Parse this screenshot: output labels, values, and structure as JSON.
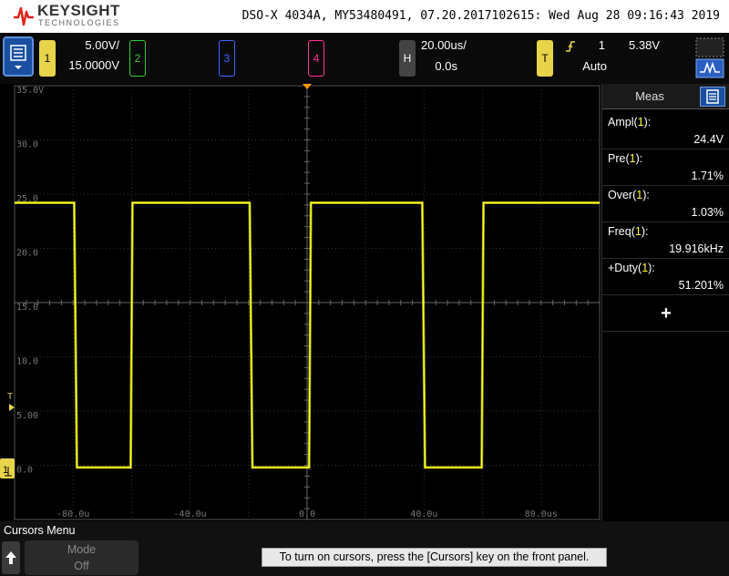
{
  "title_bar": {
    "brand": "KEYSIGHT",
    "brand_sub": "TECHNOLOGIES",
    "title": "DSO-X 4034A, MY53480491, 07.20.2017102615: Wed Aug 28 09:16:43 2019"
  },
  "toolbar": {
    "channels": [
      {
        "number": "1",
        "scale": "5.00V/",
        "offset": "15.0000V",
        "color": "#e8d44a",
        "active": true
      },
      {
        "number": "2",
        "color": "#33cc33",
        "active": false
      },
      {
        "number": "3",
        "color": "#4466ff",
        "active": false
      },
      {
        "number": "4",
        "color": "#ff3399",
        "active": false
      }
    ],
    "horizontal": {
      "label": "H",
      "timebase": "20.00us/",
      "delay": "0.0s"
    },
    "trigger": {
      "label": "T",
      "source": "1",
      "level": "5.38V",
      "mode": "Auto",
      "slope_icon": "rising-edge-icon"
    },
    "menu_icon": "menu-list-icon",
    "run_icon": "autoscale-icon"
  },
  "display": {
    "y_labels": [
      "35.0V",
      "30.0",
      "25.0",
      "20.0",
      "15.0",
      "10.0",
      "5.00",
      "0.0"
    ],
    "x_labels": [
      "-80.0u",
      "-40.0u",
      "0.0",
      "40.0u",
      "80.0us"
    ],
    "trigger_marker": "T",
    "ground_marker": "1",
    "trace_color": "#ffff22"
  },
  "meas": {
    "title": "Meas",
    "icon": "meas-list-icon",
    "rows": [
      {
        "name": "Ampl",
        "ch": "1",
        "value": "24.4V"
      },
      {
        "name": "Pre",
        "ch": "1",
        "value": "1.71%"
      },
      {
        "name": "Over",
        "ch": "1",
        "value": "1.03%"
      },
      {
        "name": "Freq",
        "ch": "1",
        "value": "19.916kHz"
      },
      {
        "name": "+Duty",
        "ch": "1",
        "value": "51.201%"
      }
    ],
    "add_label": "+"
  },
  "bottom": {
    "menu_title": "Cursors Menu",
    "mode_label": "Mode",
    "mode_value": "Off",
    "hint": "To turn on cursors, press the [Cursors] key on the front panel."
  }
}
